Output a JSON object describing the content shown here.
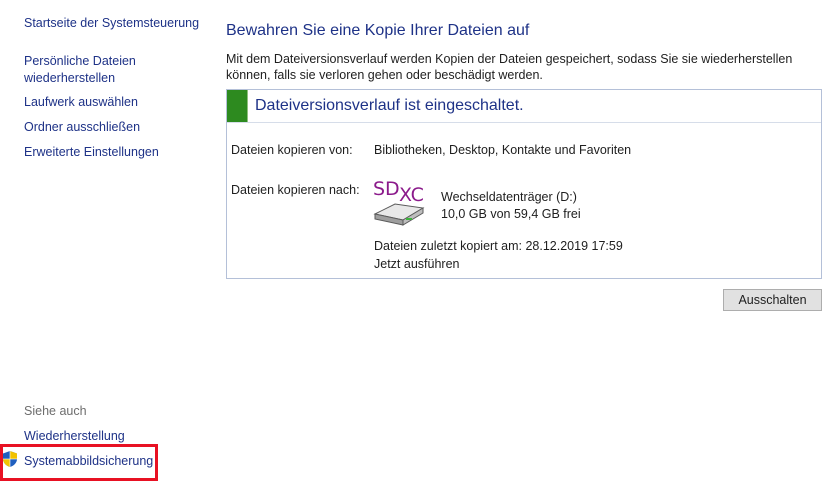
{
  "sidebar": {
    "home_link": "Startseite der Systemsteuerung",
    "restore_personal_line1": "Persönliche Dateien",
    "restore_personal_line2": "wiederherstellen",
    "select_drive": "Laufwerk auswählen",
    "exclude_folders": "Ordner ausschließen",
    "advanced_settings": "Erweiterte Einstellungen",
    "see_also": "Siehe auch",
    "recovery": "Wiederherstellung",
    "system_image_backup": "Systemabbildsicherung"
  },
  "main": {
    "title": "Bewahren Sie eine Kopie Ihrer Dateien auf",
    "description": "Mit dem Dateiversionsverlauf werden Kopien der Dateien gespeichert, sodass Sie sie wiederherstellen können, falls sie verloren gehen oder beschädigt werden.",
    "status_title": "Dateiversionsverlauf ist eingeschaltet.",
    "copy_from_label": "Dateien kopieren von:",
    "copy_from_value": "Bibliotheken, Desktop, Kontakte und Favoriten",
    "copy_to_label": "Dateien kopieren nach:",
    "drive_icon_text_sd": "SD",
    "drive_icon_text_xc": "XC",
    "drive_name": "Wechseldatenträger (D:)",
    "drive_space": "10,0 GB von 59,4 GB frei",
    "last_copied": "Dateien zuletzt kopiert am: 28.12.2019 17:59",
    "run_now": "Jetzt ausführen",
    "turn_off_button": "Ausschalten"
  },
  "colors": {
    "link": "#1e3287",
    "status_green": "#2d8a1f",
    "highlight_red": "#e81123",
    "sdxc_purple": "#8b1a8b"
  },
  "icons": {
    "shield": "uac-shield-icon",
    "drive": "sdxc-drive-icon"
  }
}
